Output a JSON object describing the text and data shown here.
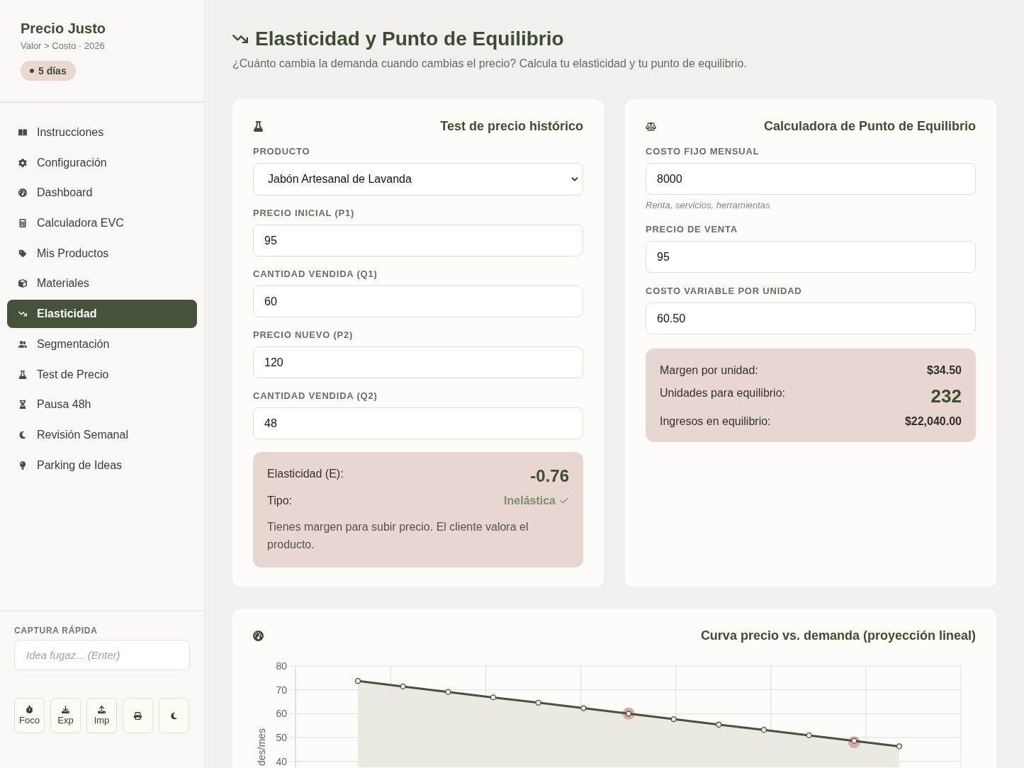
{
  "sidebar": {
    "app_title": "Precio Justo",
    "app_subtitle": "Valor > Costo · 2026",
    "badge": "5 días",
    "nav_items": [
      {
        "label": "Instrucciones",
        "selected": false
      },
      {
        "label": "Configuración",
        "selected": false
      },
      {
        "label": "Dashboard",
        "selected": false
      },
      {
        "label": "Calculadora EVC",
        "selected": false
      },
      {
        "label": "Mis Productos",
        "selected": false
      },
      {
        "label": "Materiales",
        "selected": false
      },
      {
        "label": "Elasticidad",
        "selected": true
      },
      {
        "label": "Segmentación",
        "selected": false
      },
      {
        "label": "Test de Precio",
        "selected": false
      },
      {
        "label": "Pausa 48h",
        "selected": false
      },
      {
        "label": "Revisión Semanal",
        "selected": false
      },
      {
        "label": "Parking de Ideas",
        "selected": false
      }
    ],
    "quick_capture": {
      "label": "CAPTURA RÁPIDA",
      "placeholder": "Idea fugaz... (Enter)"
    },
    "toolbar_buttons": [
      {
        "kind": "labeled",
        "label": "Foco"
      },
      {
        "kind": "labeled",
        "label": "Exp"
      },
      {
        "kind": "labeled",
        "label": "Imp"
      },
      {
        "kind": "icon"
      },
      {
        "kind": "icon"
      }
    ]
  },
  "header": {
    "title": "Elasticidad y Punto de Equilibrio",
    "subtitle": "¿Cuánto cambia la demanda cuando cambias el precio? Calcula tu elasticidad y tu punto de equilibrio."
  },
  "elasticity_card": {
    "title": "Test de precio histórico",
    "fields": [
      {
        "kind": "select",
        "label": "PRODUCTO",
        "value": "Jabón Artesanal de Lavanda"
      },
      {
        "kind": "input",
        "label": "PRECIO INICIAL (P1)",
        "value": "95"
      },
      {
        "kind": "input",
        "label": "CANTIDAD VENDIDA (Q1)",
        "value": "60"
      },
      {
        "kind": "input",
        "label": "PRECIO NUEVO (P2)",
        "value": "120"
      },
      {
        "kind": "input",
        "label": "CANTIDAD VENDIDA (Q2)",
        "value": "48"
      }
    ],
    "result": {
      "rows": [
        {
          "kind": "highlight",
          "label": "Elasticidad (E):",
          "value": "-0.76"
        },
        {
          "kind": "status",
          "label": "Tipo:",
          "value": "Inelástica"
        }
      ],
      "note": "Tienes margen para subir precio. El cliente valora el producto."
    }
  },
  "break_even_card": {
    "title": "Calculadora de Punto de Equilibrio",
    "fields": [
      {
        "kind": "input",
        "label": "COSTO FIJO MENSUAL",
        "value": "8000",
        "hint": "Renta, servicios, herramientas"
      },
      {
        "kind": "input",
        "label": "PRECIO DE VENTA",
        "value": "95"
      },
      {
        "kind": "input",
        "label": "COSTO VARIABLE POR UNIDAD",
        "value": "60.50"
      }
    ],
    "result": {
      "rows": [
        {
          "kind": "plain",
          "label": "Margen por unidad:",
          "value": "$34.50"
        },
        {
          "kind": "highlight",
          "label": "Unidades para equilibrio:",
          "value": "232"
        },
        {
          "kind": "plain",
          "label": "Ingresos en equilibrio:",
          "value": "$22,040.00"
        }
      ]
    }
  },
  "curve_card": {
    "chart_data": {
      "type": "area",
      "title": "Curva precio vs. demanda (proyección lineal)",
      "ylabel": "des/mes",
      "categories": [
        null,
        null,
        null,
        null,
        null,
        null,
        null,
        null,
        null,
        null,
        null,
        null,
        null
      ],
      "series": [
        {
          "color": "#44533a",
          "marker": "circle",
          "values": [
            73.7,
            71.4,
            69.1,
            66.8,
            64.6,
            62.3,
            60,
            57.7,
            55.4,
            53.2,
            50.9,
            48.6,
            46.3
          ]
        },
        {
          "type": "scatter",
          "color": "#dcaba3",
          "values": [
            null,
            null,
            null,
            null,
            null,
            null,
            60,
            null,
            null,
            null,
            null,
            48,
            null
          ]
        }
      ],
      "ylim": [
        37.5,
        80
      ],
      "yticks": [
        {
          "value": 40,
          "label": "40"
        },
        {
          "value": 50,
          "label": "50"
        },
        {
          "value": 60,
          "label": "60"
        },
        {
          "value": 70,
          "label": "70"
        },
        {
          "value": 80,
          "label": "80"
        }
      ],
      "grid": true
    }
  }
}
